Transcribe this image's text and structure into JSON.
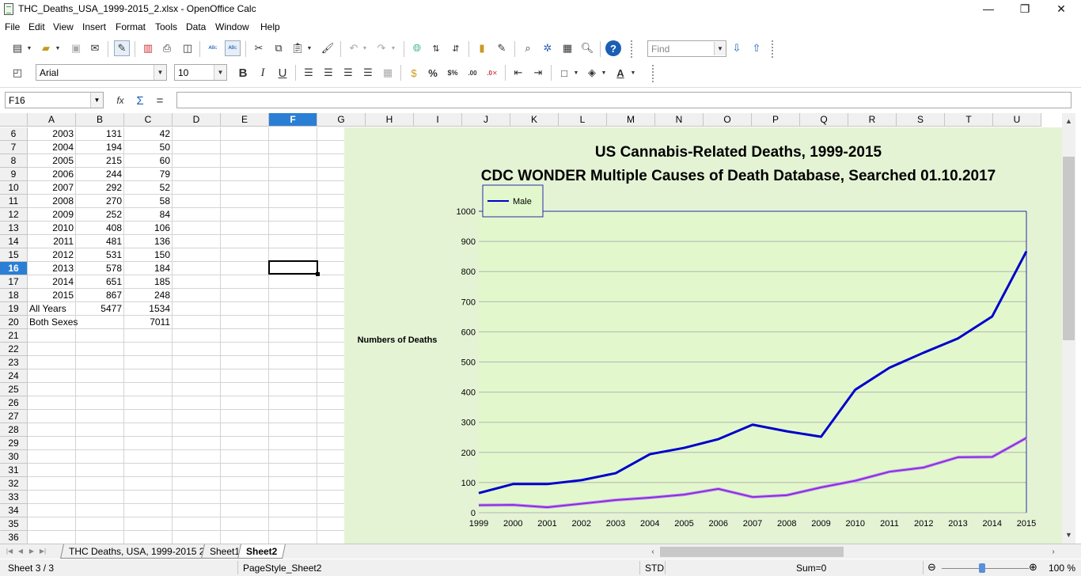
{
  "window": {
    "title": "THC_Deaths_USA_1999-2015_2.xlsx - OpenOffice Calc",
    "controls": {
      "minimize": "—",
      "restore": "❐",
      "close": "✕"
    }
  },
  "menu": [
    {
      "label": "File"
    },
    {
      "label": "Edit"
    },
    {
      "label": "View"
    },
    {
      "label": "Insert"
    },
    {
      "label": "Format"
    },
    {
      "label": "Tools"
    },
    {
      "label": "Data"
    },
    {
      "label": "Window"
    },
    {
      "label": "Help"
    }
  ],
  "toolbar": {
    "find_placeholder": "Find",
    "font_name": "Arial",
    "font_size": "10",
    "bold": "B",
    "italic": "I",
    "underline": "U",
    "percent": "%"
  },
  "formula_bar": {
    "name_box": "F16",
    "formula_value": "",
    "sum_icon": "Σ",
    "equals_icon": "=",
    "function_icon": "fx"
  },
  "grid": {
    "columns": [
      "A",
      "B",
      "C",
      "D",
      "E",
      "F",
      "G",
      "H",
      "I",
      "J",
      "K",
      "L",
      "M",
      "N",
      "O",
      "P",
      "Q",
      "R",
      "S",
      "T",
      "U"
    ],
    "selected_column": "F",
    "selected_row": "16",
    "rows": [
      {
        "num": "6",
        "a": "2003",
        "b": "131",
        "c": "42"
      },
      {
        "num": "7",
        "a": "2004",
        "b": "194",
        "c": "50"
      },
      {
        "num": "8",
        "a": "2005",
        "b": "215",
        "c": "60"
      },
      {
        "num": "9",
        "a": "2006",
        "b": "244",
        "c": "79"
      },
      {
        "num": "10",
        "a": "2007",
        "b": "292",
        "c": "52"
      },
      {
        "num": "11",
        "a": "2008",
        "b": "270",
        "c": "58"
      },
      {
        "num": "12",
        "a": "2009",
        "b": "252",
        "c": "84"
      },
      {
        "num": "13",
        "a": "2010",
        "b": "408",
        "c": "106"
      },
      {
        "num": "14",
        "a": "2011",
        "b": "481",
        "c": "136"
      },
      {
        "num": "15",
        "a": "2012",
        "b": "531",
        "c": "150"
      },
      {
        "num": "16",
        "a": "2013",
        "b": "578",
        "c": "184"
      },
      {
        "num": "17",
        "a": "2014",
        "b": "651",
        "c": "185"
      },
      {
        "num": "18",
        "a": "2015",
        "b": "867",
        "c": "248"
      },
      {
        "num": "19",
        "a": "All Years",
        "b": "5477",
        "c": "1534"
      },
      {
        "num": "20",
        "a": "Both Sexes",
        "b": "",
        "c": "7011"
      },
      {
        "num": "21",
        "a": "",
        "b": "",
        "c": ""
      },
      {
        "num": "22",
        "a": "",
        "b": "",
        "c": ""
      },
      {
        "num": "23",
        "a": "",
        "b": "",
        "c": ""
      },
      {
        "num": "24",
        "a": "",
        "b": "",
        "c": ""
      },
      {
        "num": "25",
        "a": "",
        "b": "",
        "c": ""
      },
      {
        "num": "26",
        "a": "",
        "b": "",
        "c": ""
      },
      {
        "num": "27",
        "a": "",
        "b": "",
        "c": ""
      },
      {
        "num": "28",
        "a": "",
        "b": "",
        "c": ""
      },
      {
        "num": "29",
        "a": "",
        "b": "",
        "c": ""
      },
      {
        "num": "30",
        "a": "",
        "b": "",
        "c": ""
      },
      {
        "num": "31",
        "a": "",
        "b": "",
        "c": ""
      },
      {
        "num": "32",
        "a": "",
        "b": "",
        "c": ""
      },
      {
        "num": "33",
        "a": "",
        "b": "",
        "c": ""
      },
      {
        "num": "34",
        "a": "",
        "b": "",
        "c": ""
      },
      {
        "num": "35",
        "a": "",
        "b": "",
        "c": ""
      },
      {
        "num": "36",
        "a": "",
        "b": "",
        "c": ""
      }
    ]
  },
  "chart_data": {
    "type": "line",
    "title": "US Cannabis-Related Deaths, 1999-2015",
    "subtitle": "CDC WONDER Multiple Causes of Death Database, Searched 01.10.2017",
    "ylabel": "Numbers of Deaths",
    "xlabel": "",
    "ylim": [
      0,
      1000
    ],
    "yticks": [
      "0",
      "100",
      "200",
      "300",
      "400",
      "500",
      "600",
      "700",
      "800",
      "900",
      "1000"
    ],
    "x": [
      "1999",
      "2000",
      "2001",
      "2002",
      "2003",
      "2004",
      "2005",
      "2006",
      "2007",
      "2008",
      "2009",
      "2010",
      "2011",
      "2012",
      "2013",
      "2014",
      "2015"
    ],
    "legend_position": "top-left",
    "grid": true,
    "series": [
      {
        "name": "Male",
        "color": "#0000cc",
        "values": [
          65,
          95,
          95,
          108,
          131,
          194,
          215,
          244,
          292,
          270,
          252,
          408,
          481,
          531,
          578,
          651,
          867
        ]
      },
      {
        "color": "#8a2be2",
        "values": [
          25,
          26,
          18,
          30,
          42,
          50,
          60,
          79,
          52,
          58,
          84,
          106,
          136,
          150,
          184,
          185,
          248
        ]
      }
    ],
    "background": "#e5f3d5"
  },
  "sheets": {
    "tabs": [
      {
        "label": "THC Deaths, USA, 1999-2015 2",
        "active": false
      },
      {
        "label": "Sheet1",
        "active": false
      },
      {
        "label": "Sheet2",
        "active": true
      }
    ]
  },
  "status": {
    "sheet": "Sheet 3 / 3",
    "page_style": "PageStyle_Sheet2",
    "mode": "STD",
    "sum": "Sum=0",
    "zoom": "100 %",
    "zoom_minus": "⊖",
    "zoom_plus": "⊕"
  }
}
